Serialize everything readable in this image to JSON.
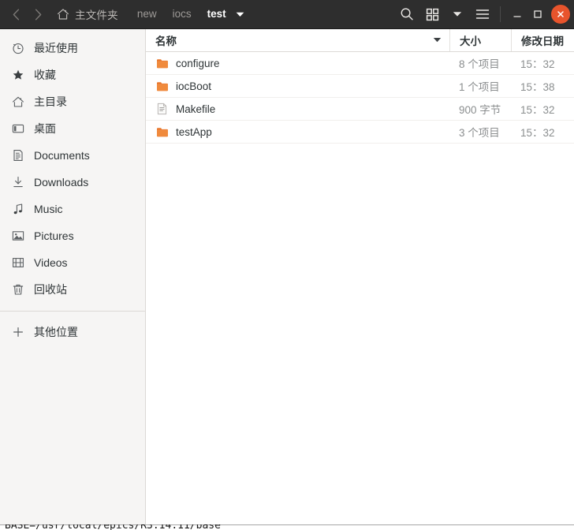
{
  "window": {
    "titlebar": {
      "nav": {
        "back_icon": "chevron-left-icon",
        "forward_icon": "chevron-right-icon"
      },
      "home_crumb": {
        "icon": "home-icon",
        "label": "主文件夹"
      },
      "breadcrumbs": [
        {
          "label": "new",
          "active": false
        },
        {
          "label": "iocs",
          "active": false
        },
        {
          "label": "test",
          "active": true
        }
      ],
      "path_dropdown_icon": "chevron-down-icon",
      "actions": [
        {
          "name": "search-button",
          "icon": "search-icon"
        },
        {
          "name": "view-grid-button",
          "icon": "grid-view-icon"
        },
        {
          "name": "view-options-button",
          "icon": "chevron-down-icon"
        },
        {
          "name": "main-menu-button",
          "icon": "hamburger-menu-icon"
        }
      ],
      "window_controls": [
        {
          "name": "minimize-button",
          "label": "—"
        },
        {
          "name": "maximize-button",
          "label": "□"
        },
        {
          "name": "close-button",
          "label": "✕"
        }
      ]
    }
  },
  "sidebar": {
    "items": [
      {
        "label": "最近使用",
        "icon": "clock-icon"
      },
      {
        "label": "收藏",
        "icon": "star-icon"
      },
      {
        "label": "主目录",
        "icon": "home-icon"
      },
      {
        "label": "桌面",
        "icon": "desktop-icon"
      },
      {
        "label": "Documents",
        "icon": "document-icon"
      },
      {
        "label": "Downloads",
        "icon": "download-icon"
      },
      {
        "label": "Music",
        "icon": "music-note-icon"
      },
      {
        "label": "Pictures",
        "icon": "image-icon"
      },
      {
        "label": "Videos",
        "icon": "film-icon"
      },
      {
        "label": "回收站",
        "icon": "trash-icon"
      }
    ],
    "other_locations": {
      "label": "其他位置",
      "icon": "plus-icon"
    }
  },
  "filelist": {
    "columns": [
      {
        "key": "name",
        "label": "名称",
        "sorted": true,
        "sort_icon": "sort-descending-arrow"
      },
      {
        "key": "size",
        "label": "大小"
      },
      {
        "key": "date",
        "label": "修改日期"
      }
    ],
    "rows": [
      {
        "name": "configure",
        "icon": "folder-icon",
        "size": "8 个项目",
        "date": "15：32"
      },
      {
        "name": "iocBoot",
        "icon": "folder-icon",
        "size": "1 个项目",
        "date": "15：38"
      },
      {
        "name": "Makefile",
        "icon": "text-file-icon",
        "size": "900 字节",
        "date": "15：32"
      },
      {
        "name": "testApp",
        "icon": "folder-icon",
        "size": "3 个项目",
        "date": "15：32"
      }
    ]
  },
  "background_terminal": {
    "visible_line": "BASE=/usr/local/epics/R3.14.11/base"
  },
  "colors": {
    "headerbar": "#2e2e2e",
    "close_button": "#e8542c",
    "folder_icon": "#e8762c",
    "sidebar_bg": "#f6f5f4",
    "text": "#2e3436",
    "muted_text": "#8b8e8f"
  }
}
